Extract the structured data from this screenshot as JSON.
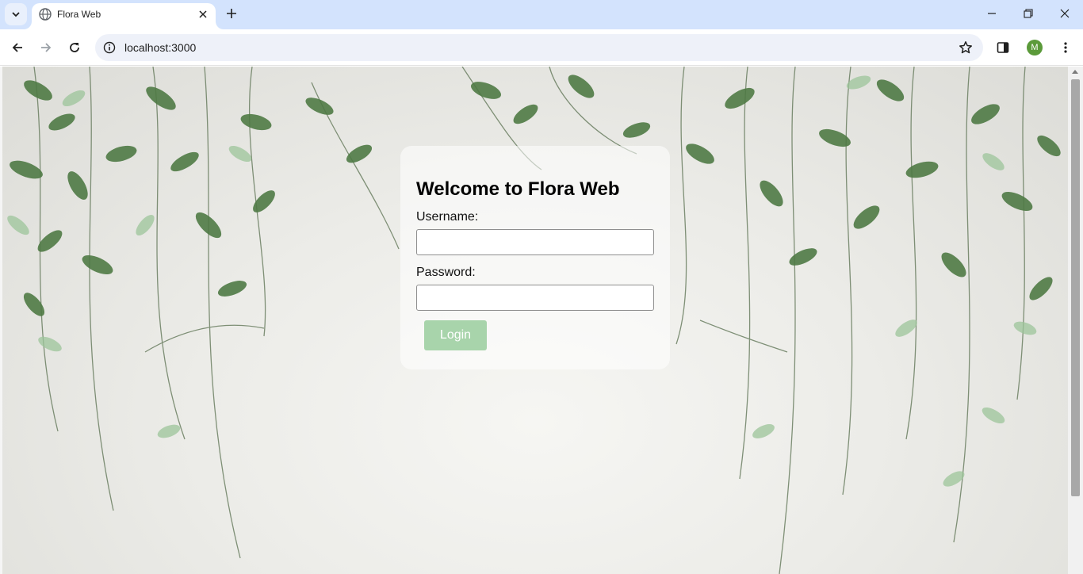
{
  "browser": {
    "tab_title": "Flora Web",
    "url": "localhost:3000",
    "profile_initial": "M"
  },
  "icons": {
    "tab_search": "chevron-down-icon",
    "favicon": "globe-icon",
    "tab_close": "close-icon",
    "new_tab": "plus-icon",
    "minimize": "minimize-icon",
    "restore": "restore-icon",
    "close_window": "close-icon",
    "back": "arrow-left-icon",
    "forward": "arrow-right-icon",
    "reload": "reload-icon",
    "site_info": "info-icon",
    "bookmark": "star-icon",
    "side_panel": "side-panel-icon",
    "menu": "more-vertical-icon"
  },
  "colors": {
    "tabstrip_bg": "#d3e3fd",
    "avatar_bg": "#5b9a3a",
    "login_button_bg": "#a8d4ab"
  },
  "login": {
    "title": "Welcome to Flora Web",
    "username_label": "Username:",
    "username_value": "",
    "password_label": "Password:",
    "password_value": "",
    "button_label": "Login"
  }
}
